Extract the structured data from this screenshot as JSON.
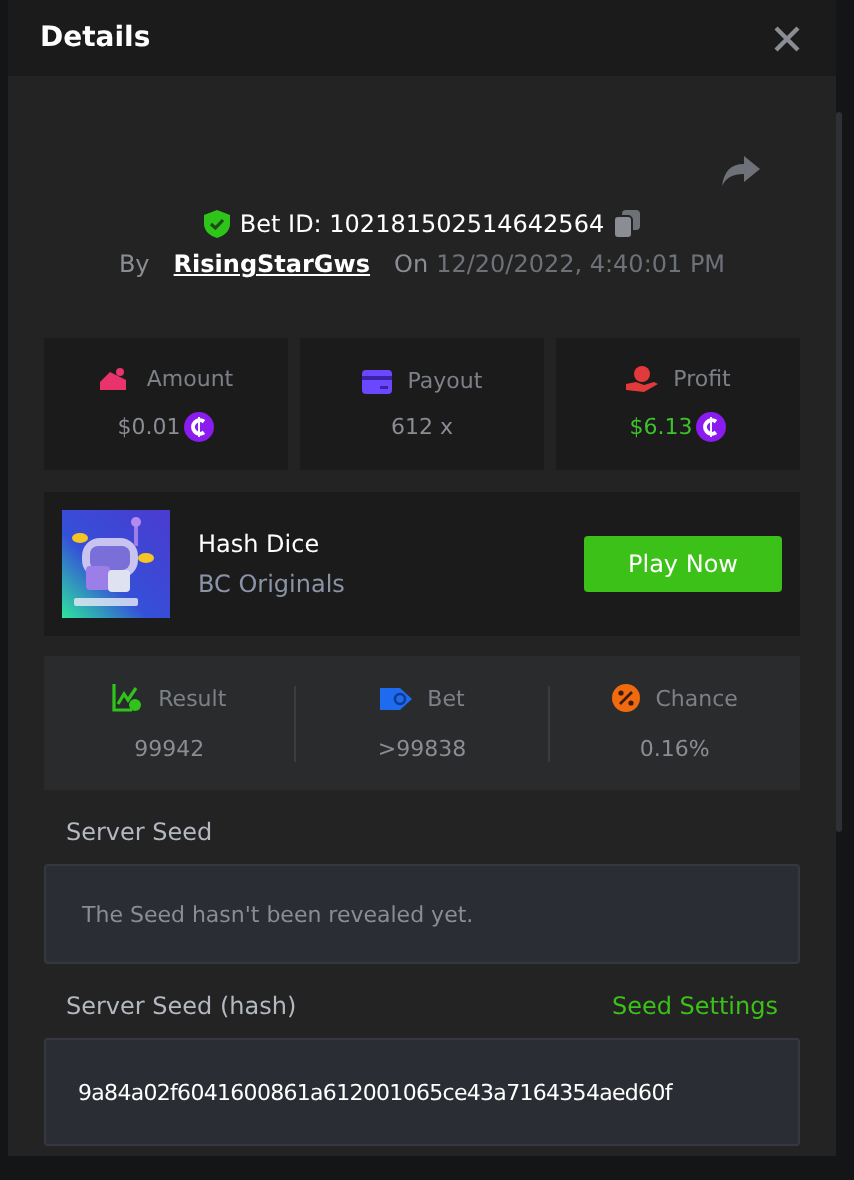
{
  "window": {
    "title": "Details"
  },
  "bet": {
    "id_label": "Bet ID: 102181502514642564",
    "by": "By",
    "user": "RisingStarGws",
    "on": "On",
    "date": "12/20/2022, 4:40:01 PM"
  },
  "stats": [
    {
      "kind": "amount",
      "label": "Amount",
      "value": "$0.01",
      "coin": true,
      "positive": false
    },
    {
      "kind": "payout",
      "label": "Payout",
      "value": "612 x",
      "coin": false,
      "positive": false
    },
    {
      "kind": "profit",
      "label": "Profit",
      "value": "$6.13",
      "coin": true,
      "positive": true
    }
  ],
  "game": {
    "title": "Hash Dice",
    "provider": "BC Originals",
    "button": "Play Now"
  },
  "results": [
    {
      "kind": "result",
      "label": "Result",
      "value": "99942"
    },
    {
      "kind": "bet",
      "label": "Bet",
      "value": ">99838"
    },
    {
      "kind": "chance",
      "label": "Chance",
      "value": "0.16%"
    }
  ],
  "server_seed": {
    "label": "Server Seed",
    "text": "The Seed hasn't been revealed yet."
  },
  "server_seed_hash": {
    "label": "Server Seed (hash)",
    "link": "Seed Settings",
    "value": "9a84a02f6041600861a612001065ce43a7164354aed60f"
  }
}
